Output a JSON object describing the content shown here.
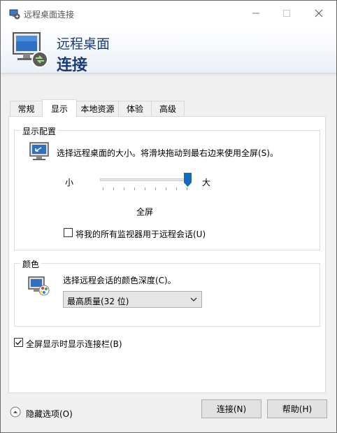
{
  "window": {
    "title": "远程桌面连接",
    "icon": "remote-desktop-icon"
  },
  "banner": {
    "line1": "远程桌面",
    "line2": "连接",
    "icon": "remote-desktop-monitor-icon"
  },
  "tabs": [
    {
      "label": "常规",
      "active": false
    },
    {
      "label": "显示",
      "active": true
    },
    {
      "label": "本地资源",
      "active": false
    },
    {
      "label": "体验",
      "active": false
    },
    {
      "label": "高级",
      "active": false
    }
  ],
  "display_config": {
    "group_title": "显示配置",
    "description": "选择远程桌面的大小。将滑块拖动到最右边来使用全屏(S)。",
    "slider_min_label": "小",
    "slider_max_label": "大",
    "slider_value_label": "全屏",
    "slider_position": 1.0,
    "multi_monitor_label": "将我的所有监视器用于远程会话(U)",
    "multi_monitor_checked": false
  },
  "colors": {
    "group_title": "颜色",
    "description": "选择远程会话的颜色深度(C)。",
    "selected_depth": "最高质量(32 位)"
  },
  "connection_bar": {
    "label": "全屏显示时显示连接栏(B)",
    "checked": true
  },
  "footer": {
    "hide_options_label": "隐藏选项(O)",
    "connect_label": "连接(N)",
    "help_label": "帮助(H)"
  },
  "theme": {
    "accent": "#1d3b78",
    "slider_thumb": "#0f6cbd"
  }
}
